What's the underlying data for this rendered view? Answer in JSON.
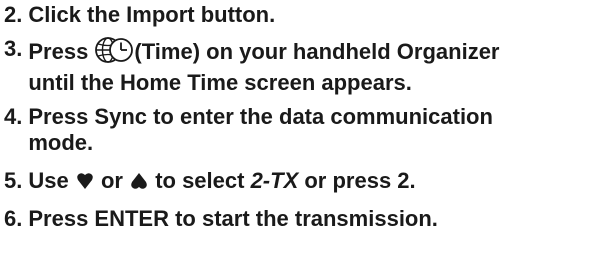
{
  "steps": [
    {
      "number": "2.",
      "lines": [
        "Click the Import  button."
      ]
    },
    {
      "number": "3.",
      "pre_icon": "Press ",
      "icon": "world-clock-icon",
      "post_icon": "(Time) on your handheld Organizer",
      "line2": "until the Home Time screen appears."
    },
    {
      "number": "4.",
      "line1": "Press Sync to enter the data communication",
      "line2": "mode."
    },
    {
      "number": "5.",
      "text_use": "Use ",
      "icon_down": "down-arrow-icon",
      "text_or": " or ",
      "icon_up": "up-arrow-icon",
      "text_select": " to select ",
      "option": "2-TX",
      "text_press": " or press 2."
    },
    {
      "number": "6.",
      "lines": [
        "Press ENTER to start the transmission."
      ]
    }
  ]
}
